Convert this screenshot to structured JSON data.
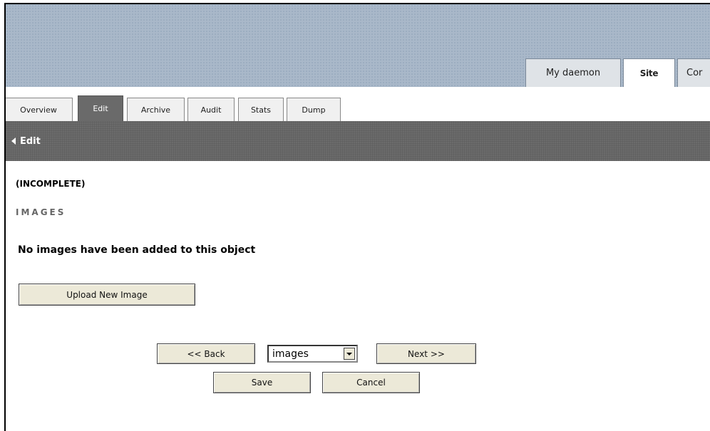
{
  "top_tabs": [
    {
      "label": "My daemon"
    },
    {
      "label": "Site",
      "active": true
    },
    {
      "label": "Cor"
    }
  ],
  "sub_tabs": [
    {
      "label": "Overview"
    },
    {
      "label": "Edit",
      "active": true
    },
    {
      "label": "Archive"
    },
    {
      "label": "Audit"
    },
    {
      "label": "Stats"
    },
    {
      "label": "Dump"
    }
  ],
  "edit_bar": {
    "back_label": "Edit",
    "icon": "triangle-left-icon"
  },
  "status": "(INCOMPLETE)",
  "section_heading": "IMAGES",
  "empty_message": "No images have been added to this object",
  "upload_button": "Upload New Image",
  "navigation": {
    "back_button": "<< Back",
    "section_select": {
      "selected": "images"
    },
    "next_button": "Next >>",
    "save_button": "Save",
    "cancel_button": "Cancel"
  },
  "colors": {
    "banner": "#a9b8c9",
    "edit_bar": "#6b6b6b",
    "active_subtab": "#6a6a6a"
  }
}
